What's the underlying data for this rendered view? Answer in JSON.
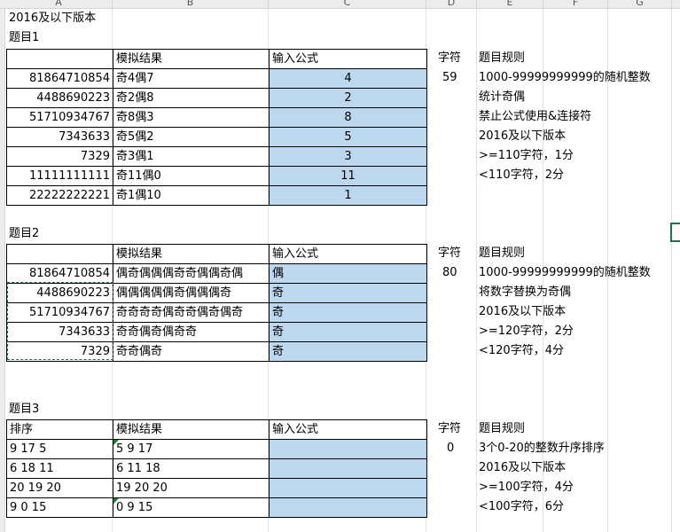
{
  "columns": [
    "A",
    "B",
    "C",
    "D",
    "E",
    "F",
    "G"
  ],
  "heading": "2016及以下版本",
  "q1": {
    "title": "题目1",
    "headers": [
      "",
      "模拟结果",
      "输入公式"
    ],
    "rows": [
      {
        "a": "81864710854",
        "b": "奇4偶7",
        "c": "4"
      },
      {
        "a": "4488690223",
        "b": "奇2偶8",
        "c": "2"
      },
      {
        "a": "51710934767",
        "b": "奇8偶3",
        "c": "8"
      },
      {
        "a": "7343633",
        "b": "奇5偶2",
        "c": "5"
      },
      {
        "a": "7329",
        "b": "奇3偶1",
        "c": "3"
      },
      {
        "a": "11111111111",
        "b": "奇11偶0",
        "c": "11"
      },
      {
        "a": "22222222221",
        "b": "奇1偶10",
        "c": "1"
      }
    ],
    "char_label": "字符",
    "char_value": "59",
    "rules_title": "题目规则",
    "rules": [
      "1000-99999999999的随机整数",
      "统计奇偶",
      "禁止公式使用&连接符",
      "2016及以下版本",
      ">=110字符，1分",
      "<110字符，2分"
    ]
  },
  "q2": {
    "title": "题目2",
    "headers": [
      "",
      "模拟结果",
      "输入公式"
    ],
    "rows": [
      {
        "a": "81864710854",
        "b": "偶奇偶偶偶奇奇偶偶奇偶",
        "c": "偶"
      },
      {
        "a": "4488690223",
        "b": "偶偶偶偶偶奇偶偶偶奇",
        "c": "奇"
      },
      {
        "a": "51710934767",
        "b": "奇奇奇奇偶奇奇偶奇偶奇",
        "c": "奇"
      },
      {
        "a": "7343633",
        "b": "奇奇偶奇偶奇奇",
        "c": "奇"
      },
      {
        "a": "7329",
        "b": "奇奇偶奇",
        "c": "奇"
      }
    ],
    "char_label": "字符",
    "char_value": "80",
    "rules_title": "题目规则",
    "rules": [
      "1000-99999999999的随机整数",
      "将数字替换为奇偶",
      "2016及以下版本",
      ">=120字符，2分",
      "<120字符，4分"
    ]
  },
  "q3": {
    "title": "题目3",
    "headers": [
      "排序",
      "模拟结果",
      "输入公式"
    ],
    "rows": [
      {
        "a": "9 17 5",
        "b": "5 9 17",
        "c": ""
      },
      {
        "a": "6 18 11",
        "b": "6 11 18",
        "c": ""
      },
      {
        "a": "20 19 20",
        "b": "19 20 20",
        "c": ""
      },
      {
        "a": "9 0 15",
        "b": "0 9 15",
        "c": ""
      }
    ],
    "char_label": "字符",
    "char_value": "0",
    "rules_title": "题目规则",
    "rules": [
      "3个0-20的整数升序排序",
      "2016及以下版本",
      ">=100字符，4分",
      "<100字符，6分"
    ]
  }
}
